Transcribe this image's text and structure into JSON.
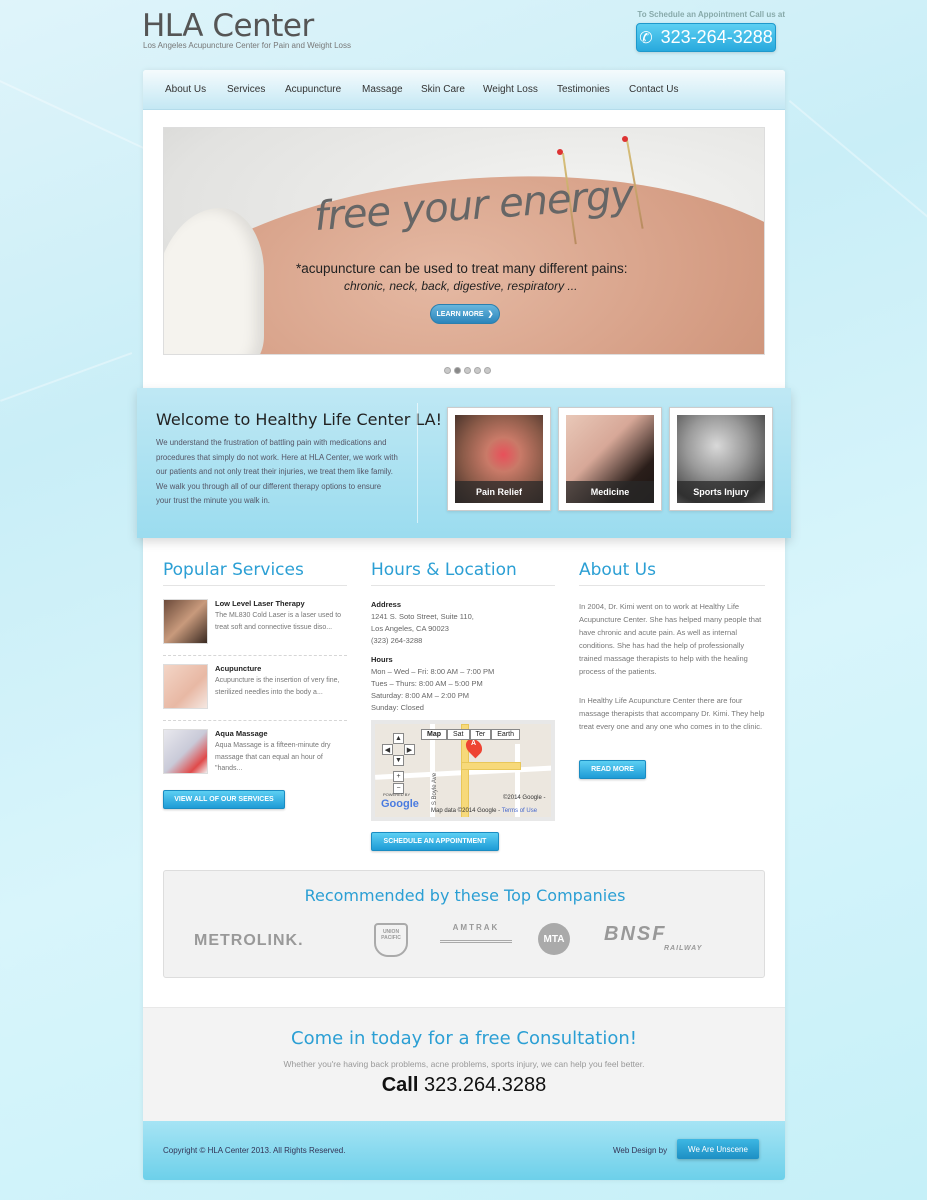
{
  "header": {
    "logo_title": "HLA Center",
    "logo_tagline": "Los Angeles Acupuncture Center for Pain and Weight Loss",
    "appointment_text": "To Schedule an Appointment Call us at",
    "phone": "323-264-3288"
  },
  "nav": {
    "items": [
      "About Us",
      "Services",
      "Acupuncture",
      "Massage",
      "Skin Care",
      "Weight Loss",
      "Testimonies",
      "Contact Us"
    ]
  },
  "slider": {
    "headline": "free your energy",
    "line1": "*acupuncture can be used to treat many different pains:",
    "line2": "chronic, neck, back, digestive, respiratory ...",
    "button": "LEARN MORE",
    "dots_total": 5,
    "active_dot": 2
  },
  "welcome": {
    "title": "Welcome to Healthy Life Center LA!",
    "text": "We understand the frustration of battling pain with medications and procedures that simply do not work. Here at HLA Center, we work with our patients and not only treat their injuries, we treat them like family. We walk you through all of our different therapy options to ensure your trust the minute you walk in.",
    "thumbs": [
      "Pain Relief",
      "Medicine",
      "Sports Injury"
    ]
  },
  "popular_services": {
    "title": "Popular Services",
    "items": [
      {
        "title": "Low Level Laser Therapy",
        "desc": "The ML830 Cold Laser is a laser used to treat soft and connective tissue diso..."
      },
      {
        "title": "Acupuncture",
        "desc": "Acupuncture is the insertion of very fine, sterilized needles into the body a..."
      },
      {
        "title": "Aqua Massage",
        "desc": "Aqua Massage is a fifteen-minute dry massage that can equal an hour of \"hands..."
      }
    ],
    "button": "VIEW ALL OF OUR SERVICES"
  },
  "hours_location": {
    "title": "Hours & Location",
    "address_label": "Address",
    "address_lines": [
      "1241 S. Soto Street, Suite 110,",
      "Los Angeles, CA 90023",
      "(323) 264-3288"
    ],
    "hours_label": "Hours",
    "hours_lines": [
      "Mon – Wed – Fri: 8:00 AM – 7:00 PM",
      "Tues – Thurs: 8:00 AM – 5:00 PM",
      "Saturday: 8:00 AM – 2:00 PM",
      "Sunday: Closed"
    ],
    "map": {
      "tabs": [
        "Map",
        "Sat",
        "Ter",
        "Earth"
      ],
      "street_label": "S Boyle Ave",
      "pin_label": "A",
      "powered_by": "POWERED BY",
      "brand": "Google",
      "copy": "©2014 Google -",
      "credit": "Map data ©2014 Google -",
      "terms": "Terms of Use"
    },
    "button": "SCHEDULE AN APPOINTMENT"
  },
  "about": {
    "title": "About Us",
    "para1": "In 2004, Dr. Kimi went on to work at Healthy Life Acupuncture Center. She has helped many people that have chronic and acute pain. As well as internal conditions. She has had the help of professionally trained massage therapists to help with the healing process of the patients.",
    "para2": "In Healthy Life Acupuncture Center there are four massage therapists that accompany Dr. Kimi. They help treat every one and any one who comes in to the clinic.",
    "button": "READ MORE"
  },
  "recommended": {
    "title": "Recommended by these Top Companies",
    "logos": [
      "METROLINK.",
      "UNION PACIFIC",
      "AMTRAK",
      "MTA",
      "BNSF",
      "RAILWAY"
    ]
  },
  "consultation": {
    "title": "Come in today for a free Consultation!",
    "subtitle": "Whether you're having back problems, acne problems, sports injury, we can help you feel better.",
    "call_label": "Call",
    "call_number": "323.264.3288"
  },
  "footer": {
    "copyright": "Copyright © HLA Center 2013. All Rights Reserved.",
    "webdesign_label": "Web Design by",
    "webdesign_brand": "We Are Unscene"
  },
  "colors": {
    "accent": "#2b9fd4",
    "button": "#28a9dd",
    "band": "#9bdcef"
  }
}
